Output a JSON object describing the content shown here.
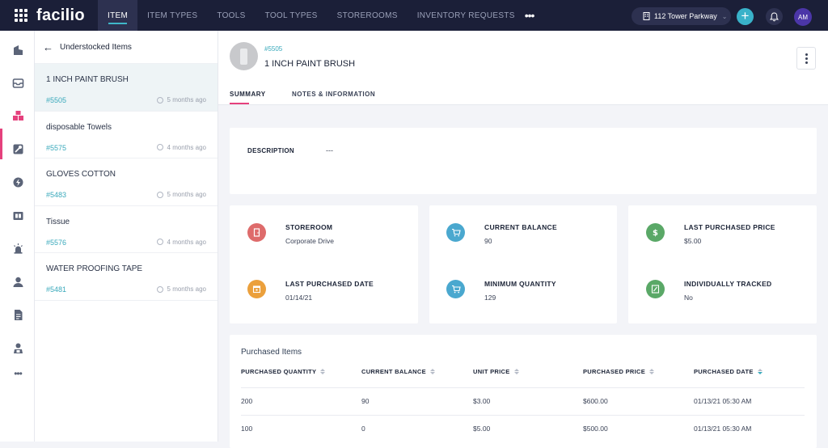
{
  "app": {
    "logo": "facilio"
  },
  "topnav": {
    "tabs": [
      "ITEM",
      "ITEM TYPES",
      "TOOLS",
      "TOOL TYPES",
      "STOREROOMS",
      "INVENTORY REQUESTS"
    ],
    "more": "•••",
    "site": "112 Tower Parkway",
    "avatar": "AM"
  },
  "colors": {
    "accent": "#e5417d",
    "teal": "#39a9bb",
    "nav_bg": "#1b1f38"
  },
  "list": {
    "title": "Understocked Items",
    "items": [
      {
        "name": "1 INCH PAINT BRUSH",
        "code": "#5505",
        "when": "5 months ago",
        "selected": true
      },
      {
        "name": "disposable Towels",
        "code": "#5575",
        "when": "4 months ago"
      },
      {
        "name": "GLOVES COTTON",
        "code": "#5483",
        "when": "5 months ago"
      },
      {
        "name": "Tissue",
        "code": "#5576",
        "when": "4 months ago"
      },
      {
        "name": "WATER PROOFING TAPE",
        "code": "#5481",
        "when": "5 months ago"
      }
    ]
  },
  "detail": {
    "code": "#5505",
    "title": "1 INCH PAINT BRUSH",
    "tabs": [
      "SUMMARY",
      "NOTES & INFORMATION"
    ],
    "description": {
      "label": "DESCRIPTION",
      "value": "---"
    },
    "stats": [
      {
        "label": "STOREROOM",
        "value": "Corporate Drive",
        "icon": "door-icon",
        "color": "#de6b6b"
      },
      {
        "label": "CURRENT BALANCE",
        "value": "90",
        "icon": "cart-icon",
        "color": "#4aa8cf"
      },
      {
        "label": "LAST PURCHASED PRICE",
        "value": "$5.00",
        "icon": "dollar-icon",
        "color": "#5aa867"
      },
      {
        "label": "LAST PURCHASED DATE",
        "value": "01/14/21",
        "icon": "calendar-icon",
        "color": "#eba03c"
      },
      {
        "label": "MINIMUM QUANTITY",
        "value": "129",
        "icon": "cart-icon",
        "color": "#4aa8cf"
      },
      {
        "label": "INDIVIDUALLY TRACKED",
        "value": "No",
        "icon": "tag-icon",
        "color": "#5aa867"
      }
    ],
    "purchased": {
      "title": "Purchased Items",
      "columns": [
        "PURCHASED QUANTITY",
        "CURRENT BALANCE",
        "UNIT PRICE",
        "PURCHASED PRICE",
        "PURCHASED DATE"
      ],
      "rows": [
        [
          "200",
          "90",
          "$3.00",
          "$600.00",
          "01/13/21 05:30 AM"
        ],
        [
          "100",
          "0",
          "$5.00",
          "$500.00",
          "01/13/21 05:30 AM"
        ]
      ]
    }
  }
}
